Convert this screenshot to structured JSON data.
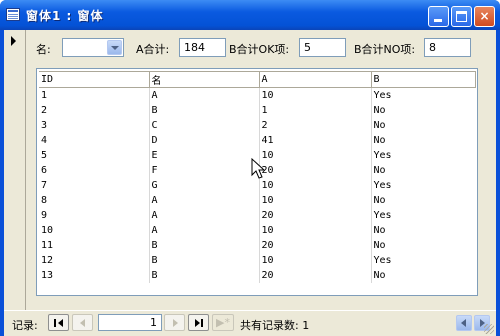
{
  "window": {
    "title": "窗体1 : 窗体",
    "buttons": {
      "minimize": "minimize",
      "maximize": "maximize",
      "close": "×"
    }
  },
  "header": {
    "name_label": "名:",
    "name_value": "",
    "a_total_label": "A合计:",
    "a_total_value": "184",
    "b_ok_label": "B合计OK项:",
    "b_ok_value": "5",
    "b_no_label": "B合计NO项:",
    "b_no_value": "8"
  },
  "table": {
    "columns": [
      "ID",
      "名",
      "A",
      "B"
    ],
    "rows": [
      [
        "1",
        "A",
        "10",
        "Yes"
      ],
      [
        "2",
        "B",
        "1",
        "No"
      ],
      [
        "3",
        "C",
        "2",
        "No"
      ],
      [
        "4",
        "D",
        "41",
        "No"
      ],
      [
        "5",
        "E",
        "10",
        "Yes"
      ],
      [
        "6",
        "F",
        "20",
        "No"
      ],
      [
        "7",
        "G",
        "10",
        "Yes"
      ],
      [
        "8",
        "A",
        "10",
        "No"
      ],
      [
        "9",
        "A",
        "20",
        "Yes"
      ],
      [
        "10",
        "A",
        "10",
        "No"
      ],
      [
        "11",
        "B",
        "20",
        "No"
      ],
      [
        "12",
        "B",
        "10",
        "Yes"
      ],
      [
        "13",
        "B",
        "20",
        "No"
      ]
    ]
  },
  "navigation": {
    "label": "记录:",
    "current_record": "1",
    "new_record_glyph": "▶*",
    "total_text": "共有记录数: 1"
  },
  "colors": {
    "titlebar": "#0452d6",
    "client": "#ece9d8",
    "field_border": "#7f9db9"
  }
}
